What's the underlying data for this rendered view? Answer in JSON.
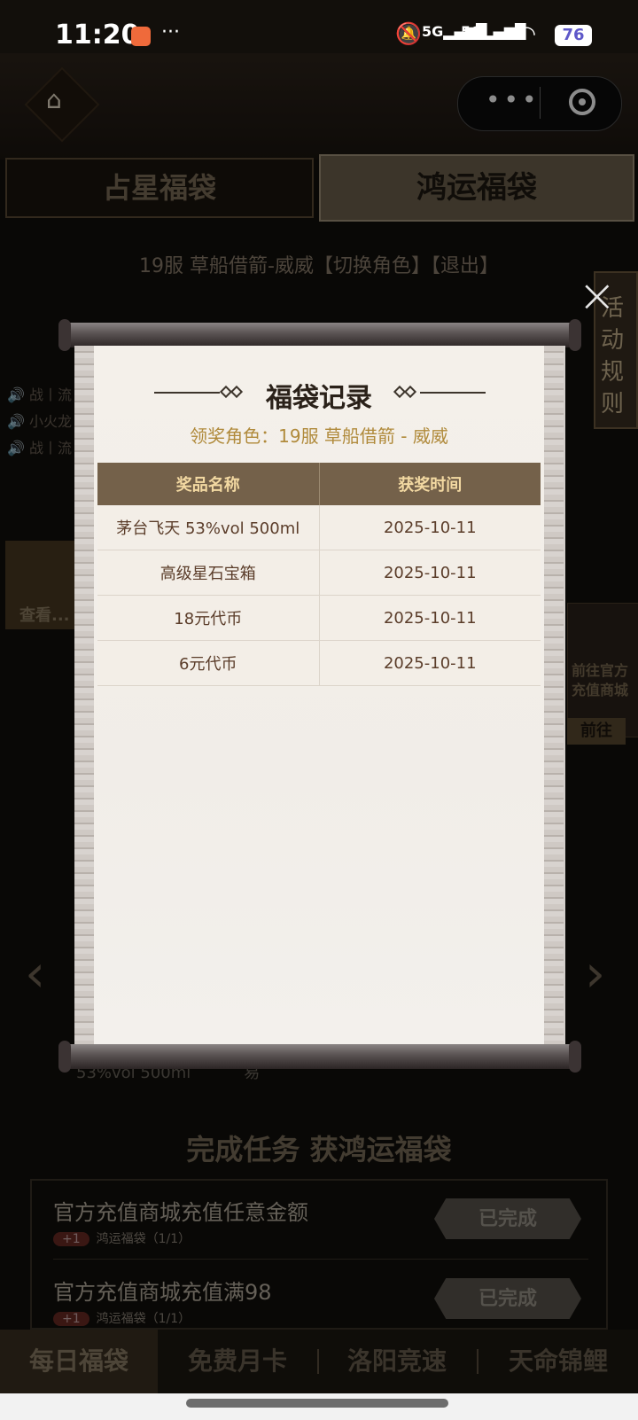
{
  "status_bar": {
    "time": "11:20",
    "more": "···",
    "sim1": "5G",
    "sim2": "5G",
    "battery": "76"
  },
  "mini_app": {
    "more_label": "•••"
  },
  "tabs": {
    "left": "占星福袋",
    "right": "鸿运福袋"
  },
  "role_line": "19服 草船借箭-威威【切换角色】【退出】",
  "side_rules": "活动规则",
  "tickers": [
    "战丨流",
    "小火龙",
    "战丨流"
  ],
  "left_card": {
    "view_label": "查看..."
  },
  "right_card": {
    "text": "前往官方充值商城",
    "button": "前往"
  },
  "background_peek": {
    "text_left": "53%vol 500ml",
    "text_right": "易"
  },
  "tasks": {
    "title": "完成任务 获鸿运福袋",
    "items": [
      {
        "name": "官方充值商城充值任意金额",
        "plus": "+1",
        "reward": "鸿运福袋（1/1）",
        "status": "已完成"
      },
      {
        "name": "官方充值商城充值满98",
        "plus": "+1",
        "reward": "鸿运福袋（1/1）",
        "status": "已完成"
      }
    ]
  },
  "bottom_nav": [
    "每日福袋",
    "免费月卡",
    "洛阳竞速",
    "天命锦鲤"
  ],
  "modal": {
    "title": "福袋记录",
    "role_info": "领奖角色：19服 草船借箭 - 威威",
    "columns": [
      "奖品名称",
      "获奖时间"
    ],
    "rows": [
      {
        "name": "茅台飞天 53%vol 500ml",
        "time": "2025-10-11"
      },
      {
        "name": "高级星石宝箱",
        "time": "2025-10-11"
      },
      {
        "name": "18元代币",
        "time": "2025-10-11"
      },
      {
        "name": "6元代币",
        "time": "2025-10-11"
      }
    ],
    "close_label": "×"
  },
  "colors": {
    "accent_gold": "#b08a3b",
    "table_header": "#74614a",
    "table_text": "#5b3d2a"
  }
}
